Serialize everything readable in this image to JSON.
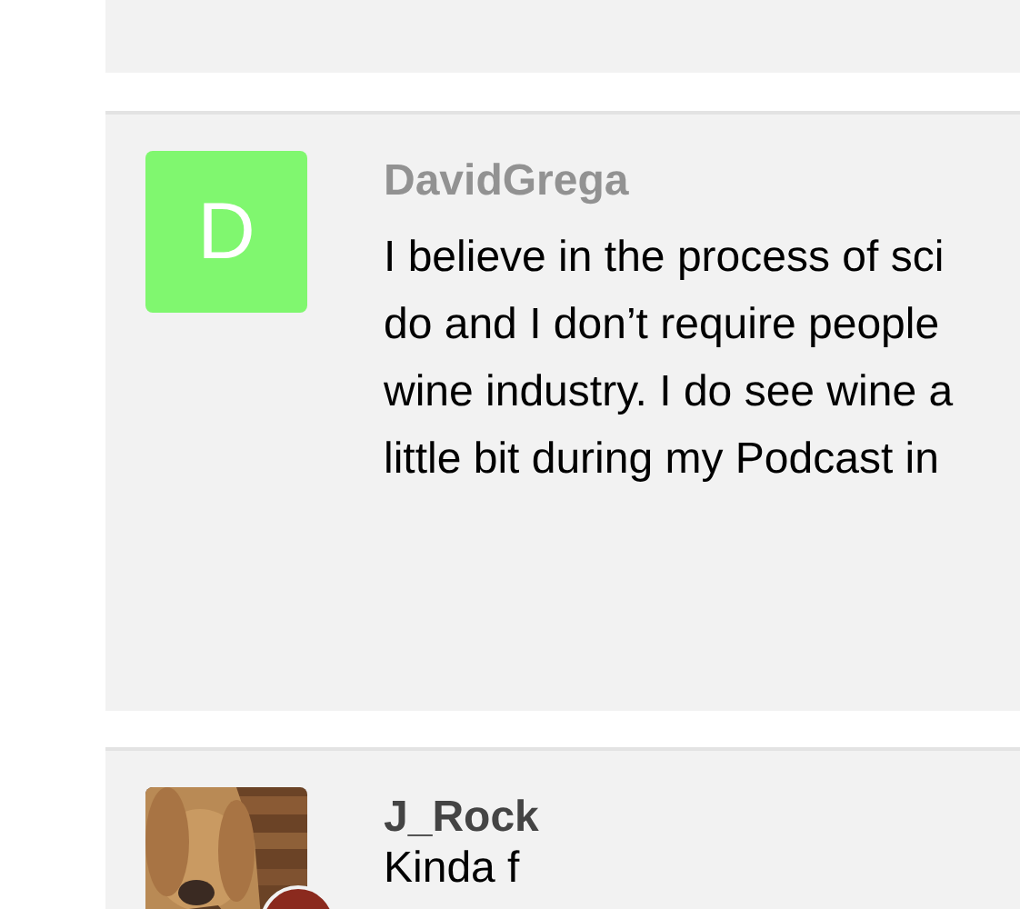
{
  "posts": [
    {
      "username": "DavidGrega",
      "dimmed": true,
      "avatar": {
        "kind": "letter",
        "letter": "D",
        "color": "#80f76f",
        "badge": false
      },
      "lines": [
        "I believe in the process of sci",
        "do and I don’t require people",
        "wine industry. I do see wine a",
        "little bit during my Podcast in"
      ]
    },
    {
      "username": "J_Rock",
      "dimmed": false,
      "avatar": {
        "kind": "picture",
        "badge": true
      },
      "lines": [
        "Kinda f"
      ]
    }
  ]
}
